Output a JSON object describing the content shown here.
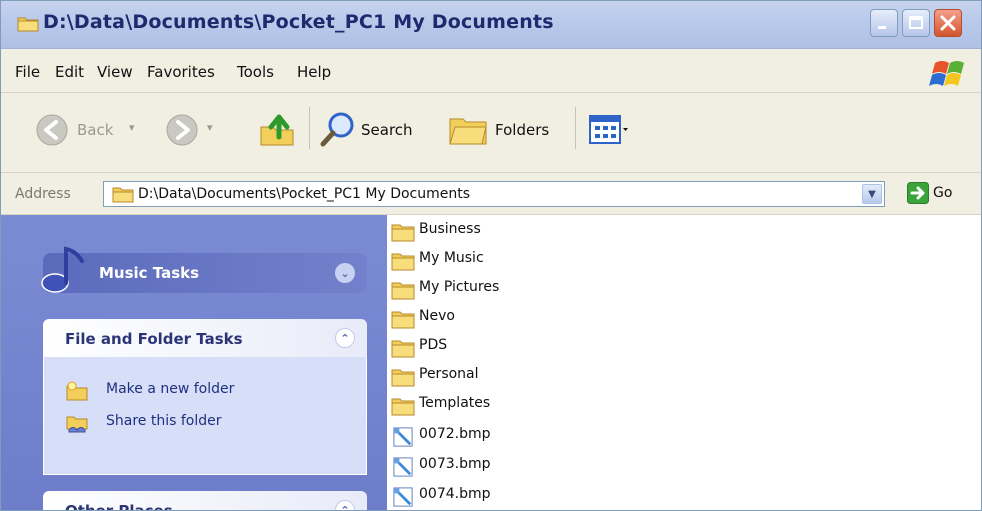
{
  "window": {
    "title": "D:\\Data\\Documents\\Pocket_PC1 My Documents"
  },
  "menu": [
    "File",
    "Edit",
    "View",
    "Favorites",
    "Tools",
    "Help"
  ],
  "toolbar": {
    "back_label": "Back",
    "search_label": "Search",
    "folders_label": "Folders"
  },
  "address": {
    "label": "Address",
    "value": "D:\\Data\\Documents\\Pocket_PC1 My Documents",
    "go_label": "Go"
  },
  "left_pane": {
    "music_tasks_title": "Music Tasks",
    "file_folder_tasks_title": "File and Folder Tasks",
    "tasks": [
      "Make a new folder",
      "Share this folder"
    ],
    "other_places_title": "Other Places"
  },
  "files": [
    {
      "name": "Business",
      "type": "folder"
    },
    {
      "name": "My Music",
      "type": "folder"
    },
    {
      "name": "My Pictures",
      "type": "folder"
    },
    {
      "name": "Nevo",
      "type": "folder"
    },
    {
      "name": "PDS",
      "type": "folder"
    },
    {
      "name": "Personal",
      "type": "folder"
    },
    {
      "name": "Templates",
      "type": "folder"
    },
    {
      "name": "0072.bmp",
      "type": "bmp"
    },
    {
      "name": "0073.bmp",
      "type": "bmp"
    },
    {
      "name": "0074.bmp",
      "type": "bmp"
    }
  ],
  "colors": {
    "titlebar": "#b9c9ea",
    "chrome": "#f1efe2",
    "task_pane": "#7b8bd3",
    "folder": "#f5d76e",
    "close_button": "#d2542f"
  }
}
